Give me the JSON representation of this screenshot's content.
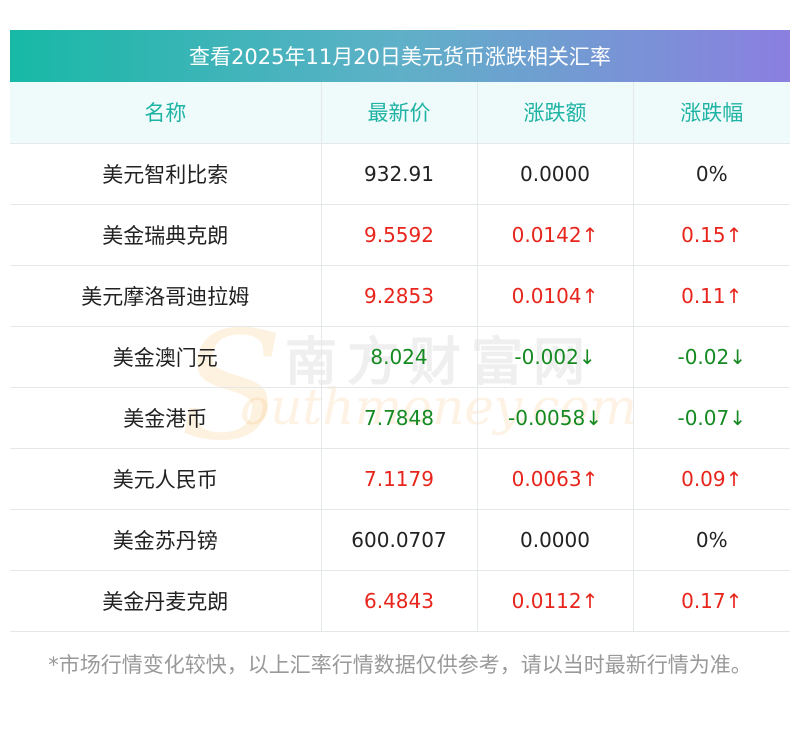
{
  "title": "查看2025年11月20日美元货币涨跌相关汇率",
  "columns": [
    "名称",
    "最新价",
    "涨跌额",
    "涨跌幅"
  ],
  "rows": [
    {
      "name": "美元智利比索",
      "price": "932.91",
      "change": "0.0000",
      "pct": "0%",
      "dir": "flat"
    },
    {
      "name": "美金瑞典克朗",
      "price": "9.5592",
      "change": "0.0142↑",
      "pct": "0.15↑",
      "dir": "up"
    },
    {
      "name": "美元摩洛哥迪拉姆",
      "price": "9.2853",
      "change": "0.0104↑",
      "pct": "0.11↑",
      "dir": "up"
    },
    {
      "name": "美金澳门元",
      "price": "8.024",
      "change": "-0.002↓",
      "pct": "-0.02↓",
      "dir": "down"
    },
    {
      "name": "美金港币",
      "price": "7.7848",
      "change": "-0.0058↓",
      "pct": "-0.07↓",
      "dir": "down"
    },
    {
      "name": "美元人民币",
      "price": "7.1179",
      "change": "0.0063↑",
      "pct": "0.09↑",
      "dir": "up"
    },
    {
      "name": "美金苏丹镑",
      "price": "600.0707",
      "change": "0.0000",
      "pct": "0%",
      "dir": "flat"
    },
    {
      "name": "美金丹麦克朗",
      "price": "6.4843",
      "change": "0.0112↑",
      "pct": "0.17↑",
      "dir": "up"
    }
  ],
  "watermark": {
    "letter": "S",
    "cn": "南方财富网",
    "en": "outhmoney.com"
  },
  "footnote": "*市场行情变化较快，以上汇率行情数据仅供参考，请以当时最新行情为准。",
  "colors": {
    "up": "#e8251c",
    "down": "#168a22",
    "header_text": "#1fb3a4",
    "header_bg": "#effbfb"
  }
}
